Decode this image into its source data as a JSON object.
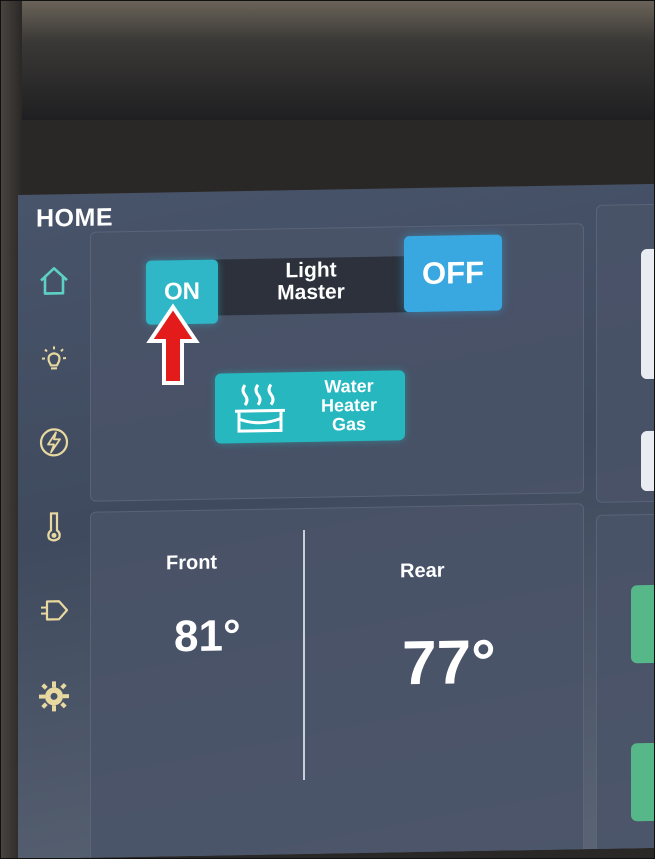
{
  "screen": {
    "title": "HOME"
  },
  "nav": [
    {
      "name": "home",
      "icon": "home-icon"
    },
    {
      "name": "lights",
      "icon": "light-bulb-icon"
    },
    {
      "name": "power",
      "icon": "lightning-icon"
    },
    {
      "name": "climate",
      "icon": "thermometer-icon"
    },
    {
      "name": "slides",
      "icon": "slide-icon"
    },
    {
      "name": "settings",
      "icon": "gear-icon"
    }
  ],
  "light_master": {
    "on_label": "ON",
    "label_line1": "Light",
    "label_line2": "Master",
    "off_label": "OFF"
  },
  "water_heater": {
    "line1": "Water",
    "line2": "Heater",
    "line3": "Gas",
    "icon": "water-heater-icon"
  },
  "climate": {
    "front": {
      "name": "Front",
      "temp": "81°"
    },
    "rear": {
      "name": "Rear",
      "temp": "77°"
    }
  },
  "annotation": {
    "icon": "red-up-arrow-icon",
    "color": "#e31b1b"
  },
  "colors": {
    "accent_teal": "#2fb6c7",
    "accent_blue": "#3aa8e0",
    "nav_icon": "#e8d9a0",
    "nav_active": "#5ed0c6"
  }
}
